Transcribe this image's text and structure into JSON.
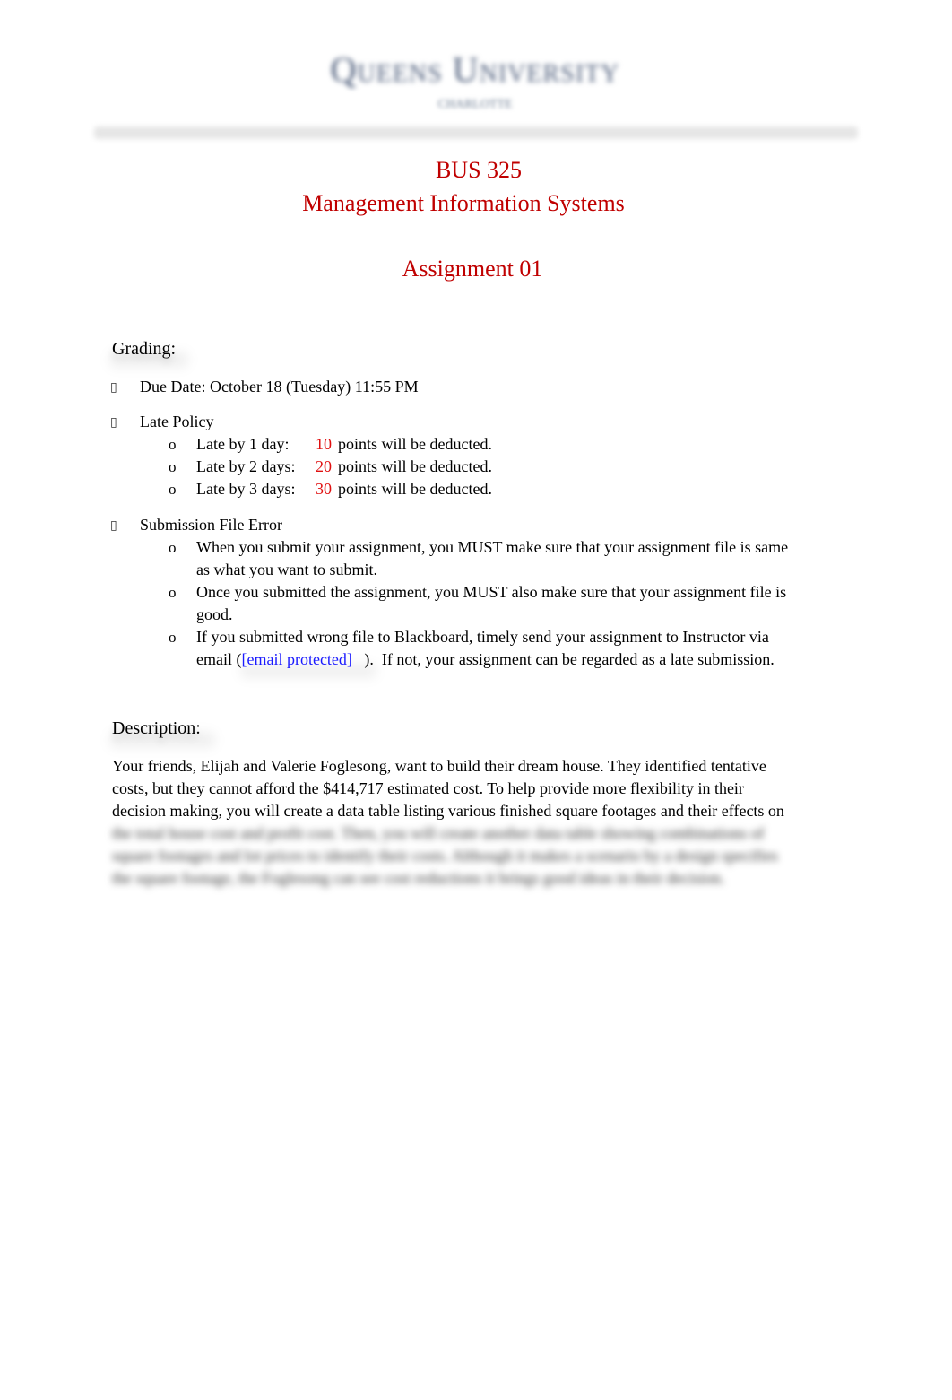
{
  "header": {
    "logo_name": "Queens University",
    "logo_subtitle": "CHARLOTTE"
  },
  "title": {
    "course_code": "BUS 325",
    "course_name": "Management Information Systems",
    "assignment": "Assignment 01"
  },
  "grading": {
    "heading": "Grading:",
    "bullet_icon": "",
    "due_date": "Due Date: October 18 (Tuesday) 11:55 PM",
    "late_policy": {
      "label": "Late Policy",
      "sub_bullet": "o",
      "items": [
        {
          "label": "Late by 1 day:",
          "points": "10",
          "suffix": "points will be deducted."
        },
        {
          "label": "Late by 2 days:",
          "points": "20",
          "suffix": "points will be deducted."
        },
        {
          "label": "Late by 3 days:",
          "points": "30",
          "suffix": "points will be deducted."
        }
      ]
    },
    "submission_error": {
      "label": "Submission File Error",
      "items": [
        {
          "line1": "When you submit your assignment, you MUST make sure that your assignment file is same",
          "line2": "as what you want to submit."
        },
        {
          "line1": "Once you submitted the assignment, you MUST  also make sure that your assignment file is",
          "line2": "good."
        },
        {
          "line1": "If you submitted wrong file to Blackboard, timely send your assignment to Instructor via",
          "line2_prefix": "email (",
          "line2_link": "[email protected]",
          "line2_suffix": "   ).  If not, your assignment can be regarded as a late submission."
        }
      ]
    }
  },
  "description": {
    "heading": "Description:",
    "lines": [
      "Your friends, Elijah and Valerie Foglesong, want to build their dream house. They identified tentative",
      "costs, but they cannot afford the $414,717 estimated cost. To help provide more flexibility in their",
      "decision making, you will create a data table listing various finished square footages and their effects on"
    ],
    "blurred_lines": [
      "the total house cost and profit cost. Then, you will create another data table showing combinations of",
      "square footages and lot prices to identify their costs. Although it makes a scenario by a design specifies",
      "the square footage, the Foglesong can see cost reductions it brings good ideas in their decision."
    ]
  }
}
